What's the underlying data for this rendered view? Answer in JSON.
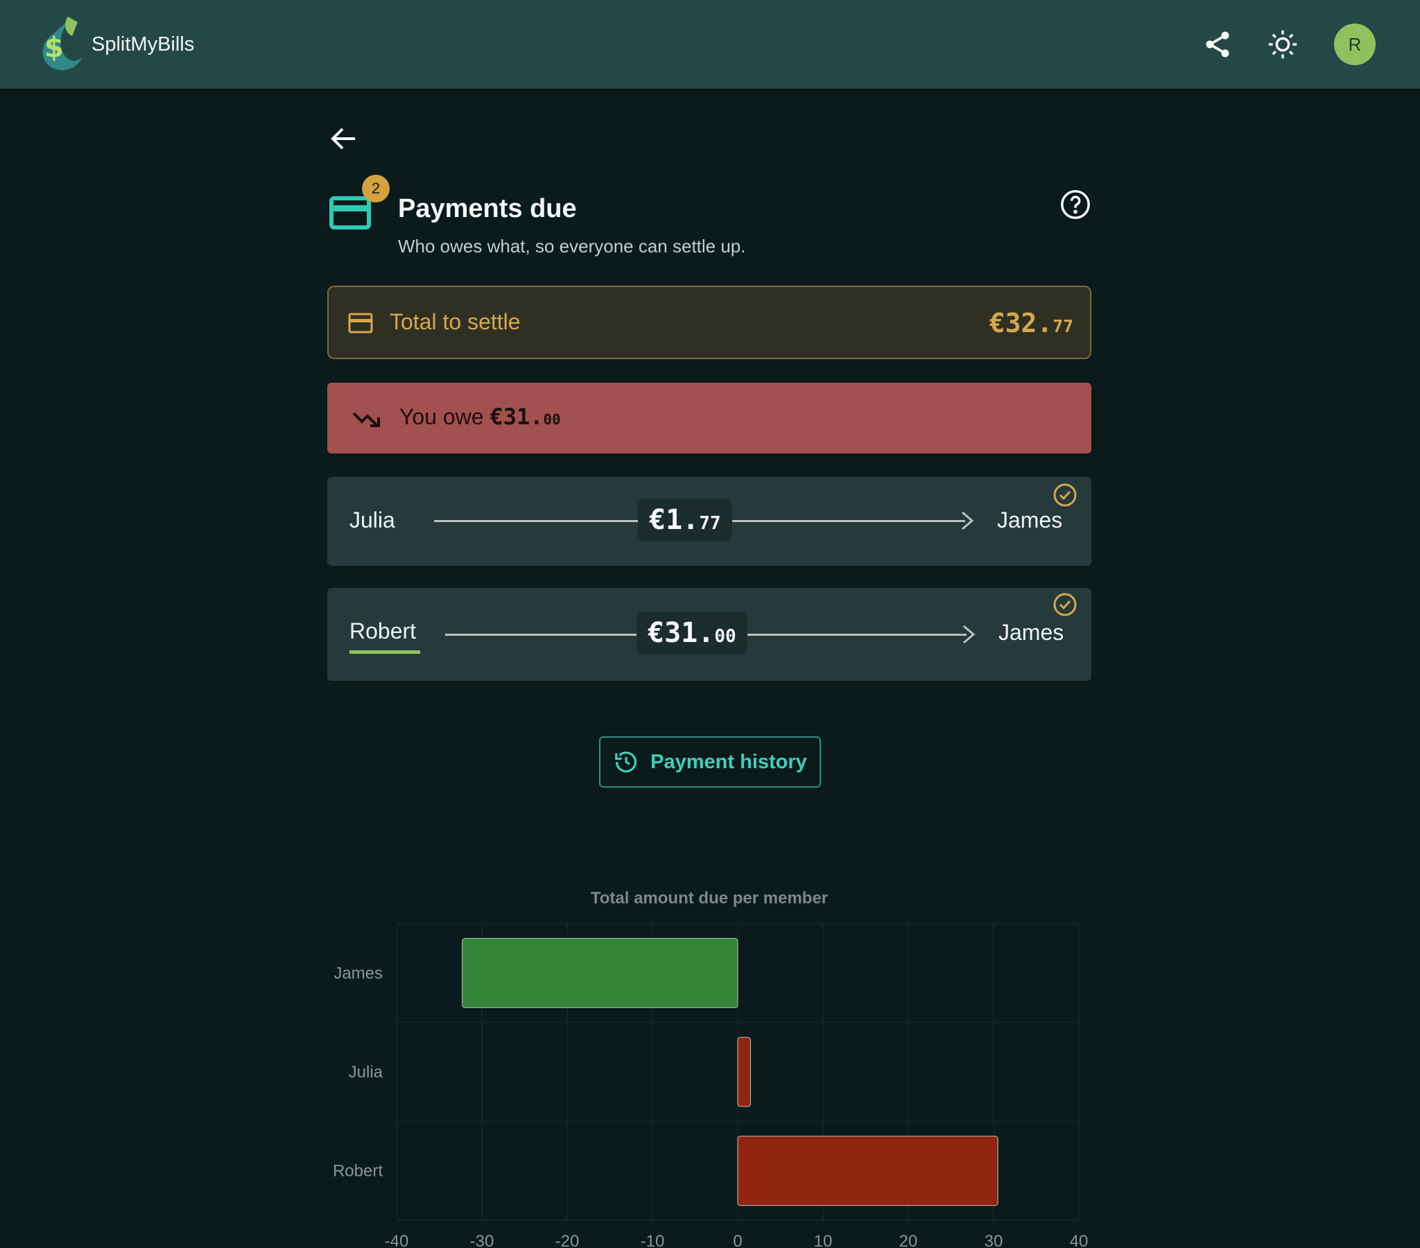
{
  "app": {
    "name": "SplitMyBills",
    "avatar_initial": "R"
  },
  "header": {
    "badge_count": "2",
    "title": "Payments due",
    "subtitle": "Who owes what, so everyone can settle up."
  },
  "total": {
    "label": "Total to settle",
    "currency": "€",
    "amount_main": "32.",
    "amount_cents": "77"
  },
  "owe": {
    "prefix": "You owe",
    "amount_main": "€31.",
    "amount_cents": "00"
  },
  "payments": [
    {
      "from": "Julia",
      "to": "James",
      "amount_main": "€1.",
      "amount_cents": "77"
    },
    {
      "from": "Robert",
      "to": "James",
      "amount_main": "€31.",
      "amount_cents": "00"
    }
  ],
  "history_button": {
    "label": "Payment history"
  },
  "colors": {
    "accent_teal": "#3fcfbd",
    "gold": "#d6a84a",
    "owe_red": "#a35050",
    "bar_positive": "#338538",
    "bar_negative": "#912311"
  },
  "chart_data": {
    "type": "bar",
    "orientation": "horizontal",
    "title": "Total amount due per member",
    "categories": [
      "James",
      "Julia",
      "Robert"
    ],
    "values": [
      -32.3,
      1.5,
      30.5
    ],
    "xlim": [
      -40,
      40
    ],
    "xticks": [
      -40,
      -30,
      -20,
      -10,
      0,
      10,
      20,
      30,
      40
    ],
    "grid": true,
    "legend": "none"
  }
}
